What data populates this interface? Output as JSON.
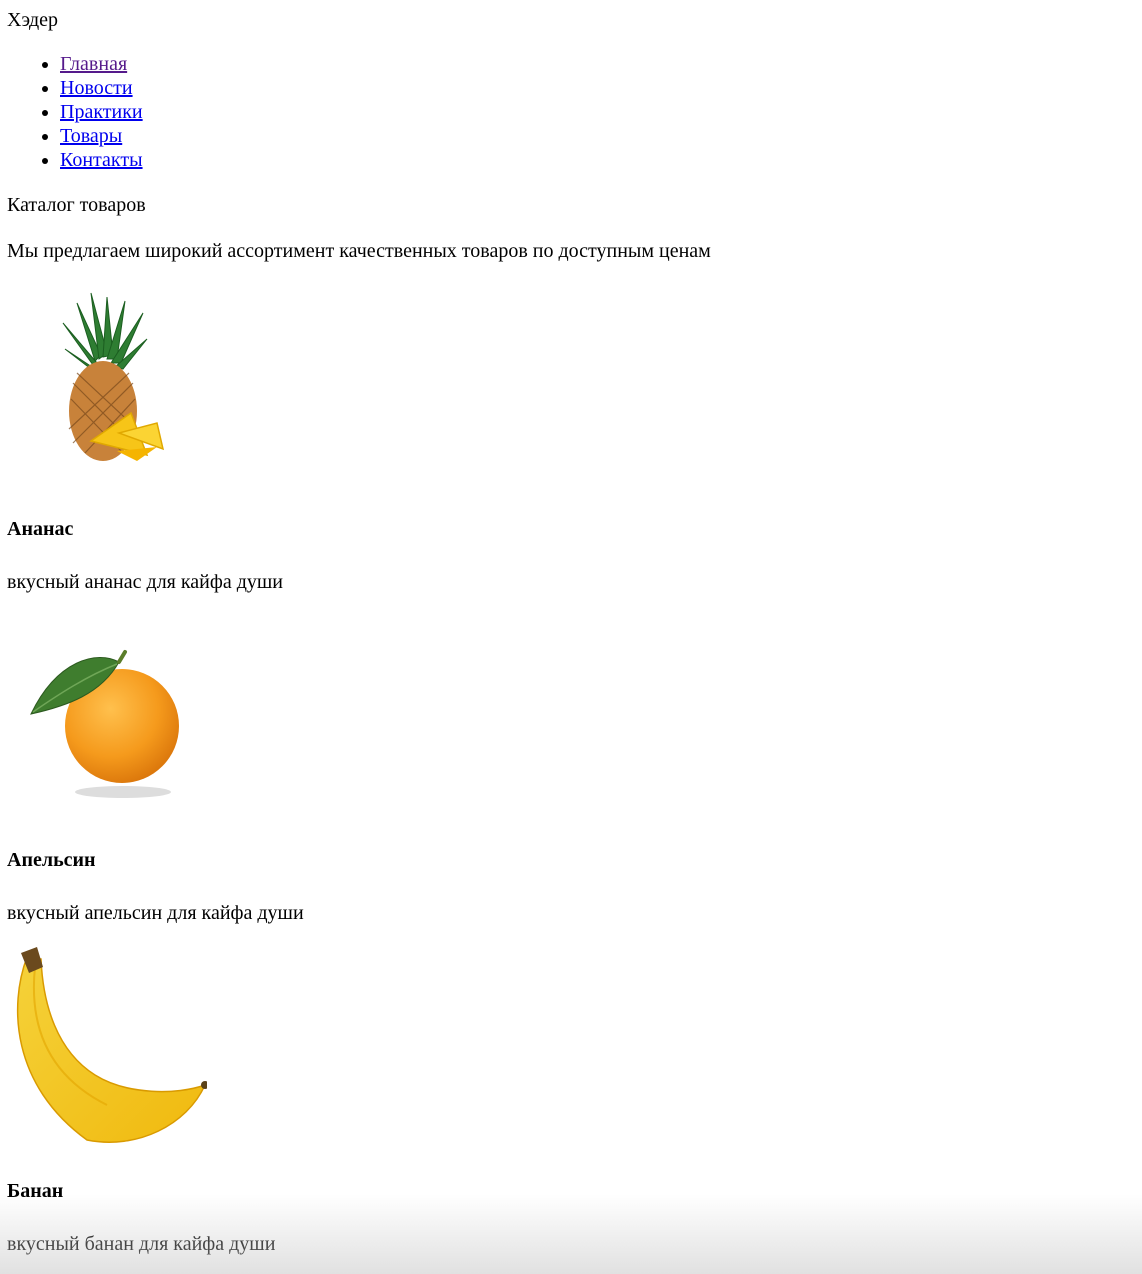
{
  "header": {
    "title": "Хэдер"
  },
  "nav": {
    "items": [
      {
        "label": "Главная"
      },
      {
        "label": "Новости"
      },
      {
        "label": "Практики"
      },
      {
        "label": "Товары"
      },
      {
        "label": "Контакты"
      }
    ]
  },
  "catalog": {
    "title": "Каталог товаров",
    "description": "Мы предлагаем широкий ассортимент качественных товаров по доступным ценам"
  },
  "products": [
    {
      "name": "Ананас",
      "description": "вкусный ананас для кайфа души",
      "icon": "pineapple-image"
    },
    {
      "name": "Апельсин",
      "description": "вкусный апельсин для кайфа души",
      "icon": "orange-image"
    },
    {
      "name": "Банан",
      "description": "вкусный банан для кайфа души",
      "icon": "banana-image"
    }
  ]
}
